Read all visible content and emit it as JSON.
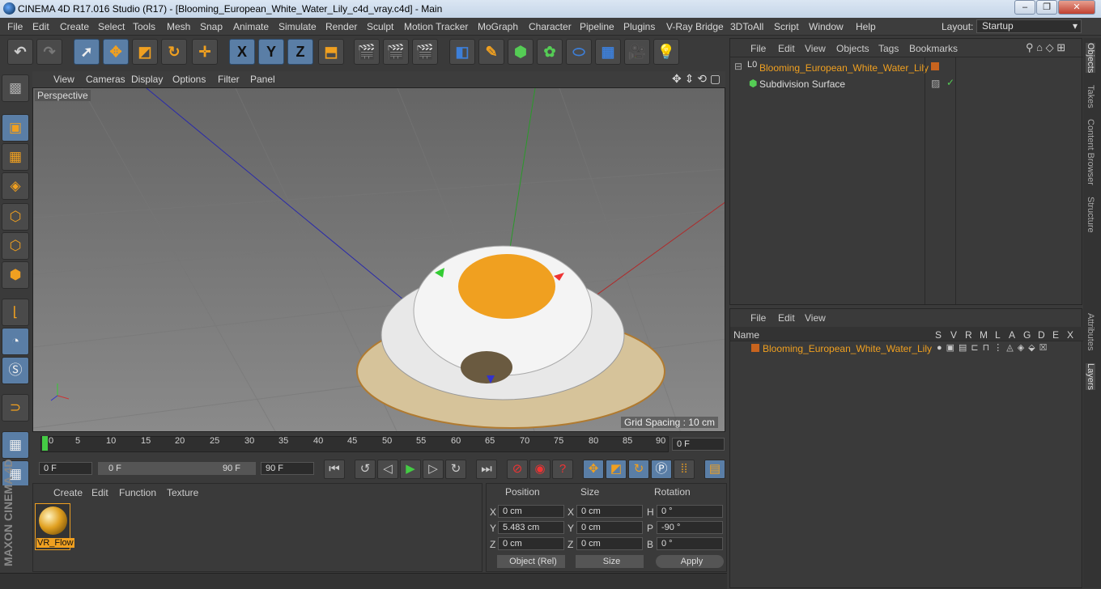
{
  "window": {
    "title": "CINEMA 4D R17.016 Studio (R17) - [Blooming_European_White_Water_Lily_c4d_vray.c4d] - Main"
  },
  "menu": [
    "File",
    "Edit",
    "Create",
    "Select",
    "Tools",
    "Mesh",
    "Snap",
    "Animate",
    "Simulate",
    "Render",
    "Sculpt",
    "Motion Tracker",
    "MoGraph",
    "Character",
    "Pipeline",
    "Plugins",
    "V-Ray Bridge",
    "3DToAll",
    "Script",
    "Window",
    "Help"
  ],
  "layout": {
    "label": "Layout:",
    "value": "Startup"
  },
  "toolbar": {
    "x_label": "X",
    "y_label": "Y",
    "z_label": "Z"
  },
  "viewport": {
    "menu": [
      "View",
      "Cameras",
      "Display",
      "Options",
      "Filter",
      "Panel"
    ],
    "label": "Perspective",
    "grid_spacing": "Grid Spacing : 10 cm"
  },
  "timeline": {
    "ticks": [
      "0",
      "5",
      "10",
      "15",
      "20",
      "25",
      "30",
      "35",
      "40",
      "45",
      "50",
      "55",
      "60",
      "65",
      "70",
      "75",
      "80",
      "85",
      "90"
    ],
    "current_frame": "0 F",
    "start": "0 F",
    "range_start": "0 F",
    "range_end": "90 F",
    "end": "90 F"
  },
  "materials": {
    "menu": [
      "Create",
      "Edit",
      "Function",
      "Texture"
    ],
    "items": [
      {
        "name": "VR_Flow"
      }
    ]
  },
  "coordinates": {
    "headers": {
      "position": "Position",
      "size": "Size",
      "rotation": "Rotation"
    },
    "rows": [
      {
        "axis": "X",
        "pos": "0 cm",
        "size_axis": "X",
        "size": "0 cm",
        "rot_axis": "H",
        "rot": "0 °"
      },
      {
        "axis": "Y",
        "pos": "5.483 cm",
        "size_axis": "Y",
        "size": "0 cm",
        "rot_axis": "P",
        "rot": "-90 °"
      },
      {
        "axis": "Z",
        "pos": "0 cm",
        "size_axis": "Z",
        "size": "0 cm",
        "rot_axis": "B",
        "rot": "0 °"
      }
    ],
    "mode": "Object (Rel)",
    "size_mode": "Size",
    "apply": "Apply"
  },
  "objects": {
    "menu": [
      "File",
      "Edit",
      "View",
      "Objects",
      "Tags",
      "Bookmarks"
    ],
    "items": [
      {
        "name": "Blooming_European_White_Water_Lily"
      },
      {
        "name": "Subdivision Surface"
      }
    ]
  },
  "layers": {
    "menu": [
      "File",
      "Edit",
      "View"
    ],
    "columns": {
      "name": "Name",
      "flags": [
        "S",
        "V",
        "R",
        "M",
        "L",
        "A",
        "G",
        "D",
        "E",
        "X"
      ]
    },
    "items": [
      {
        "name": "Blooming_European_White_Water_Lily"
      }
    ]
  },
  "side_tabs": [
    "Objects",
    "Takes",
    "Content Browser",
    "Structure",
    "Attributes",
    "Layers"
  ],
  "brand": "MAXON CINEMA 4D",
  "colors": {
    "accent": "#f0a020",
    "active": "#5a7ea6"
  }
}
